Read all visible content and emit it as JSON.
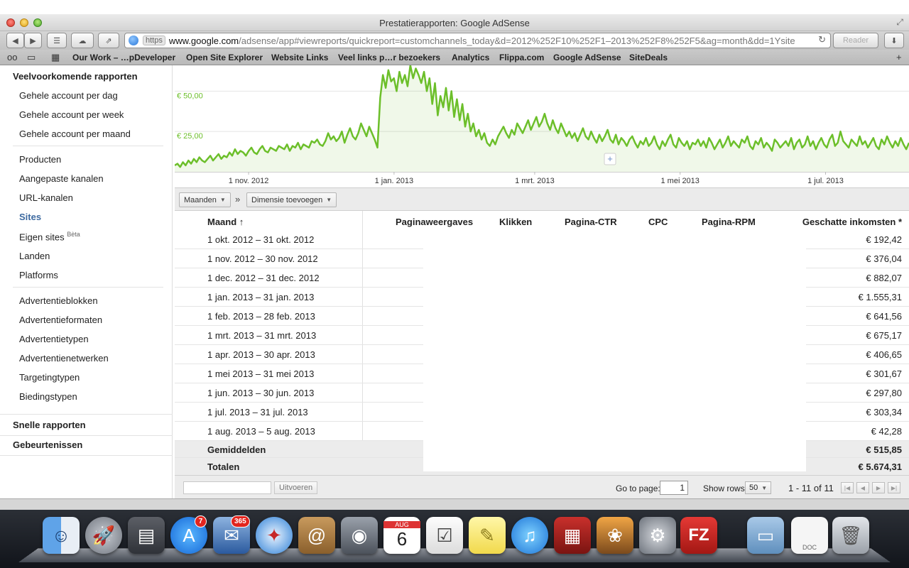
{
  "window": {
    "title": "Prestatierapporten: Google AdSense"
  },
  "toolbar": {
    "url_scheme": "https",
    "url_host": "www.google.com",
    "url_path": "/adsense/app#viewreports/quickreport=customchannels_today&d=2012%252F10%252F1–2013%252F8%252F5&ag=month&dd=1Ysite",
    "reader_label": "Reader"
  },
  "bookmarks": [
    "Our Work – …pDeveloper",
    "Open Site Explorer",
    "Website Links",
    "Veel links p…r bezoekers",
    "Analytics",
    "Flippa.com",
    "Google AdSense",
    "SiteDeals"
  ],
  "sidebar": {
    "section_title": "Veelvoorkomende rapporten",
    "group1": [
      "Gehele account per dag",
      "Gehele account per week",
      "Gehele account per maand"
    ],
    "group2": [
      "Producten",
      "Aangepaste kanalen",
      "URL-kanalen",
      "Sites",
      "Eigen sites",
      "Landen",
      "Platforms"
    ],
    "beta_label": "Bèta",
    "group3": [
      "Advertentieblokken",
      "Advertentieformaten",
      "Advertentietypen",
      "Advertentienetwerken",
      "Targetingtypen",
      "Biedingstypen"
    ],
    "quick_reports": "Snelle rapporten",
    "events": "Gebeurtenissen"
  },
  "chart_data": {
    "type": "line",
    "y_tick_labels": [
      "€ 50,00",
      "€ 25,00"
    ],
    "y_ticks": [
      50,
      25
    ],
    "x_tick_labels": [
      "1 nov. 2012",
      "1 jan. 2013",
      "1 mrt. 2013",
      "1 mei 2013",
      "1 jul. 2013"
    ],
    "ylim": [
      0,
      66
    ],
    "x_range": [
      "2012-10-01",
      "2013-08-05"
    ],
    "grid": true,
    "color": "#6cbf2a",
    "values": [
      4,
      5,
      3,
      6,
      4,
      7,
      5,
      8,
      6,
      9,
      7,
      6,
      8,
      10,
      7,
      9,
      11,
      8,
      10,
      9,
      12,
      10,
      14,
      11,
      13,
      12,
      10,
      13,
      15,
      12,
      11,
      14,
      16,
      13,
      12,
      15,
      14,
      13,
      16,
      15,
      14,
      17,
      13,
      16,
      15,
      18,
      14,
      17,
      16,
      15,
      19,
      18,
      20,
      17,
      16,
      19,
      24,
      20,
      22,
      19,
      21,
      25,
      18,
      23,
      27,
      22,
      20,
      24,
      30,
      26,
      22,
      28,
      24,
      20,
      15,
      46,
      60,
      52,
      63,
      56,
      58,
      50,
      62,
      55,
      60,
      53,
      66,
      58,
      64,
      60,
      55,
      62,
      50,
      58,
      42,
      55,
      35,
      47,
      40,
      52,
      38,
      50,
      34,
      45,
      32,
      42,
      28,
      36,
      25,
      30,
      22,
      26,
      20,
      24,
      18,
      16,
      20,
      17,
      22,
      25,
      28,
      24,
      21,
      26,
      23,
      30,
      27,
      24,
      28,
      32,
      26,
      30,
      34,
      28,
      31,
      36,
      30,
      26,
      32,
      27,
      24,
      30,
      26,
      22,
      25,
      21,
      24,
      19,
      23,
      27,
      22,
      20,
      25,
      21,
      18,
      23,
      19,
      22,
      26,
      20,
      18,
      23,
      17,
      21,
      19,
      16,
      20,
      22,
      18,
      15,
      19,
      17,
      21,
      16,
      18,
      22,
      17,
      14,
      19,
      16,
      20,
      23,
      17,
      15,
      21,
      18,
      16,
      19,
      14,
      18,
      17,
      20,
      16,
      19,
      15,
      21,
      18,
      14,
      17,
      20,
      15,
      18,
      22,
      16,
      19,
      17,
      15,
      20,
      18,
      22,
      16,
      14,
      19,
      17,
      21,
      15,
      18,
      16,
      13,
      20,
      18,
      15,
      17,
      19,
      16,
      21,
      14,
      18,
      20,
      15,
      17,
      22,
      16,
      19,
      14,
      18,
      21,
      17,
      15,
      20,
      23,
      16,
      18,
      25,
      19,
      17,
      15,
      20,
      18,
      16,
      22,
      17,
      19,
      15,
      18,
      21,
      16,
      14,
      20,
      17,
      22,
      18,
      15,
      19,
      16,
      21,
      17,
      14,
      18
    ]
  },
  "controls": {
    "group_by": "Maanden",
    "add_dimension": "Dimensie toevoegen"
  },
  "table": {
    "columns": [
      "Maand ↑",
      "Paginaweergaves",
      "Klikken",
      "Pagina-CTR",
      "CPC",
      "Pagina-RPM",
      "Geschatte inkomsten *"
    ],
    "rows": [
      {
        "month": "1 okt. 2012 – 31 okt. 2012",
        "earnings": "€ 192,42"
      },
      {
        "month": "1 nov. 2012 – 30 nov. 2012",
        "earnings": "€ 376,04"
      },
      {
        "month": "1 dec. 2012 – 31 dec. 2012",
        "earnings": "€ 882,07"
      },
      {
        "month": "1 jan. 2013 – 31 jan. 2013",
        "earnings": "€ 1.555,31"
      },
      {
        "month": "1 feb. 2013 – 28 feb. 2013",
        "earnings": "€ 641,56"
      },
      {
        "month": "1 mrt. 2013 – 31 mrt. 2013",
        "earnings": "€ 675,17"
      },
      {
        "month": "1 apr. 2013 – 30 apr. 2013",
        "earnings": "€ 406,65"
      },
      {
        "month": "1 mei 2013 – 31 mei 2013",
        "earnings": "€ 301,67"
      },
      {
        "month": "1 jun. 2013 – 30 jun. 2013",
        "earnings": "€ 297,80"
      },
      {
        "month": "1 jul. 2013 – 31 jul. 2013",
        "earnings": "€ 303,34"
      },
      {
        "month": "1 aug. 2013 – 5 aug. 2013",
        "earnings": "€ 42,28"
      }
    ],
    "average": {
      "label": "Gemiddelden",
      "earnings": "€ 515,85"
    },
    "total": {
      "label": "Totalen",
      "earnings": "€ 5.674,31"
    }
  },
  "pager": {
    "run_label": "Uitvoeren",
    "goto_label": "Go to page:",
    "goto_value": "1",
    "rows_label": "Show rows:",
    "rows_value": "50",
    "range_label": "1 - 11 of 11"
  },
  "dock": {
    "calendar_month": "AUG",
    "calendar_day": "6",
    "appstore_badge": "7",
    "mail_badge": "365",
    "doc_label": "DOC",
    "filezilla_label": "FZ"
  }
}
